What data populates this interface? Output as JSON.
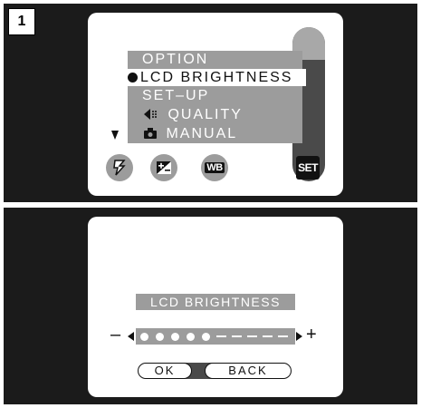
{
  "step": "1",
  "menu": {
    "option_label": "OPTION",
    "lcd_brightness_label": "LCD BRIGHTNESS",
    "setup_label": "SET–UP",
    "quality_label": "QUALITY",
    "manual_label": "MANUAL"
  },
  "toolbar": {
    "icons": [
      "flash-icon",
      "exposure-compensation-icon",
      "white-balance-icon"
    ],
    "wb_label": "WB",
    "set_label": "SET"
  },
  "brightness_screen": {
    "title": "LCD BRIGHTNESS",
    "minus_label": "–",
    "plus_label": "+",
    "level": 5,
    "max_level": 10,
    "ok_label": "OK",
    "back_label": "BACK"
  },
  "colors": {
    "panel_bg": "#1b1b1b",
    "menu_gray": "#9c9c9c",
    "dark_gray": "#4a4a4a",
    "selected_bg": "#ffffff"
  }
}
